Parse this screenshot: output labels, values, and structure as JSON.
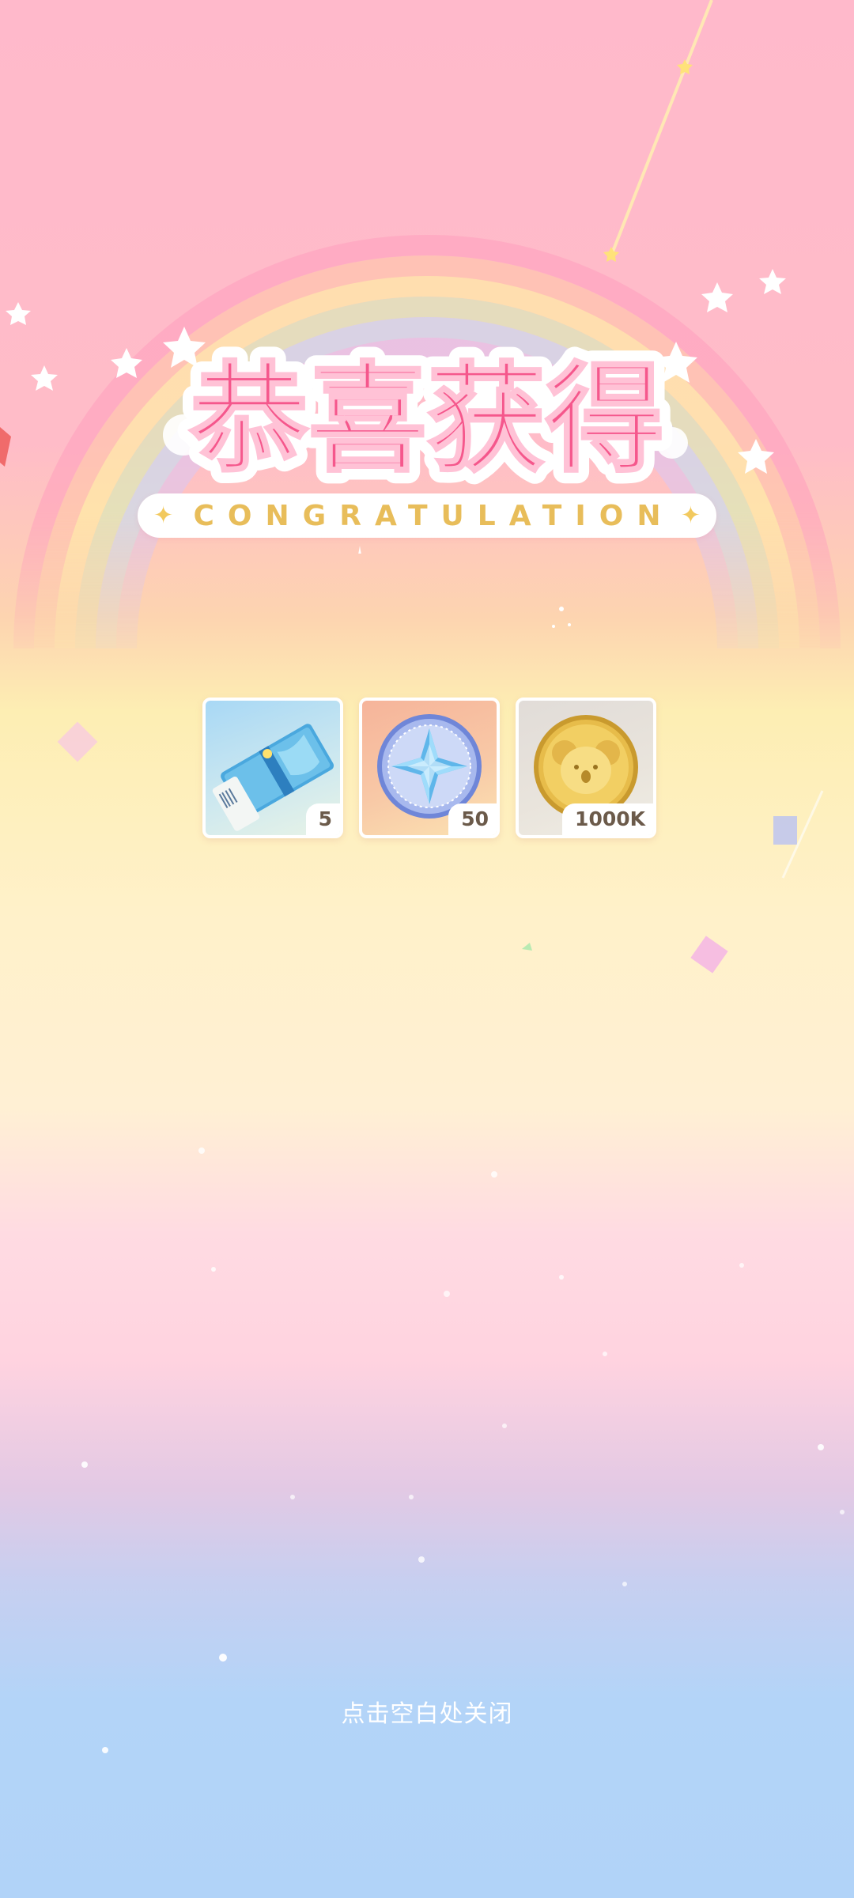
{
  "title": "恭喜获得",
  "subtitle": "CONGRATULATION",
  "rewards": [
    {
      "icon": "ticket-icon",
      "quantity": "5"
    },
    {
      "icon": "star-compass-medal-icon",
      "quantity": "50"
    },
    {
      "icon": "koala-gold-coin-icon",
      "quantity": "1000K"
    }
  ],
  "close_hint": "点击空白处关闭",
  "colors": {
    "title_fill": "#f5578c",
    "title_accent": "#ffc94a",
    "subtitle_text": "#e8bd5a",
    "background_top": "#ffb9cb",
    "background_bottom": "#b1d3f8"
  }
}
